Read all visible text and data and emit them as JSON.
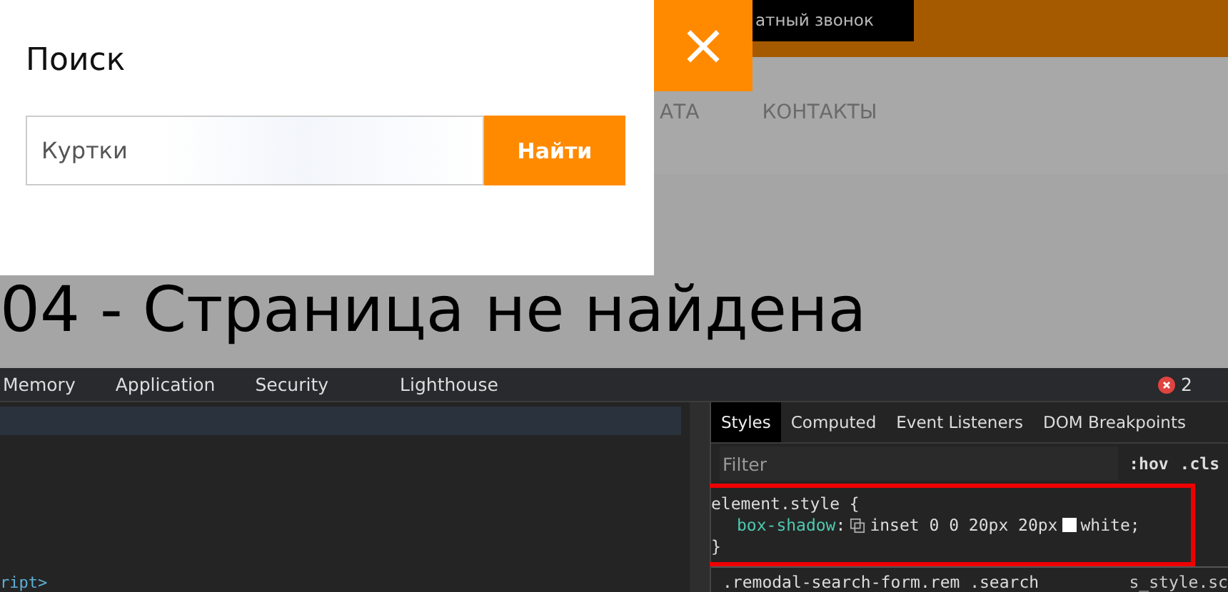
{
  "page": {
    "callback_button": "атный звонок",
    "nav": [
      "АТА",
      "КОНТАКТЫ"
    ],
    "heading": "04 - Страница не найдена"
  },
  "modal": {
    "title": "Поиск",
    "search_value": "Куртки",
    "submit": "Найти",
    "close": "×"
  },
  "devtools": {
    "tabs": [
      {
        "label": "Memory",
        "selected": false
      },
      {
        "label": "Application",
        "selected": false
      },
      {
        "label": "Security",
        "selected": false
      },
      {
        "label": "Lighthouse",
        "selected": false
      }
    ],
    "error_count": "2",
    "code_line": "ript>",
    "styles_tabs": [
      {
        "label": "Styles",
        "selected": true
      },
      {
        "label": "Computed",
        "selected": false
      },
      {
        "label": "Event Listeners",
        "selected": false
      },
      {
        "label": "DOM Breakpoints",
        "selected": false
      }
    ],
    "filter_placeholder": "Filter",
    "hov": ":hov",
    "cls": ".cls",
    "rule": {
      "selector": "element.style {",
      "property": "box-shadow",
      "separator": ":",
      "value_before": "inset 0 0 20px 20px",
      "value_after": "white;",
      "close": "}",
      "highlighted": true
    },
    "next_rule": {
      "selector": ".remodal-search-form.rem .search",
      "source": "s_style.sc"
    }
  }
}
